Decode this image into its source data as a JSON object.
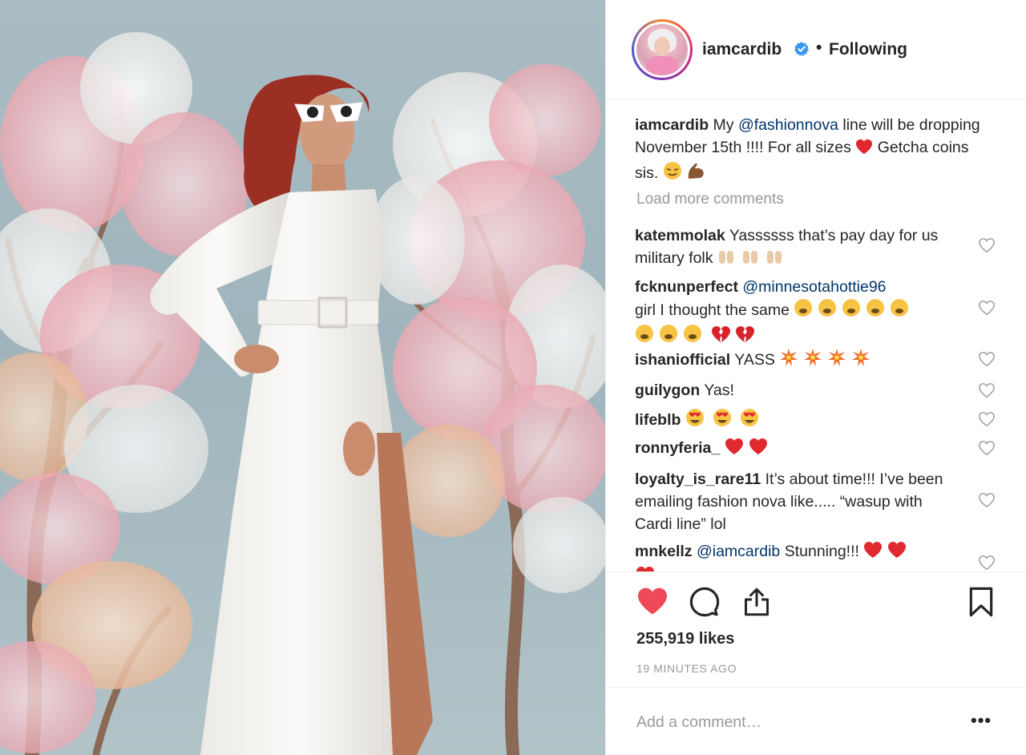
{
  "post": {
    "image_alt": "Woman in white dress among cherry blossom trees",
    "author": "iamcardib",
    "follow_status": "Following",
    "dot": "•",
    "caption": {
      "username": "iamcardib",
      "pre": "My ",
      "mention": "@fashionnova",
      "text": " line will be dropping November 15th !!!! For all sizes ",
      "text2": "Getcha coins sis."
    },
    "load_more": "Load more comments",
    "comments": [
      {
        "username": "katemmolak",
        "text": "Yassssss that’s pay day for us military folk"
      },
      {
        "username": "fcknunperfect",
        "mention": "@minnesotahottie96",
        "text": "girl I thought the same"
      },
      {
        "username": "ishaniofficial",
        "text": "YASS"
      },
      {
        "username": "guilygon",
        "text": "Yas!"
      },
      {
        "username": "lifeblb",
        "text": ""
      },
      {
        "username": "ronnyferia_",
        "text": ""
      },
      {
        "username": "loyalty_is_rare11",
        "text": "It’s about time!!! I’ve been emailing fashion nova like..... “wasup with Cardi line” lol"
      },
      {
        "username": "mnkellz",
        "mention": "@iamcardib",
        "text": "Stunning!!!"
      }
    ],
    "likes": "255,919 likes",
    "timestamp": "19 MINUTES AGO",
    "add_comment_placeholder": "Add a comment…",
    "more_options": "•••"
  },
  "icons": {
    "like": "heart-filled-icon",
    "comment": "comment-bubble-icon",
    "share": "share-icon",
    "save": "bookmark-icon",
    "verified": "verified-badge-icon"
  },
  "colors": {
    "like_red": "#ed4956",
    "mention_blue": "#003569",
    "muted_gray": "#999999",
    "verified_blue": "#3897f0"
  }
}
